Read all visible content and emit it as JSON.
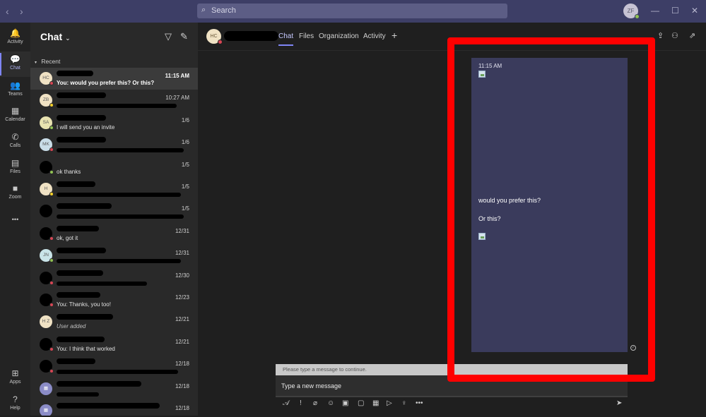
{
  "titlebar": {
    "search_placeholder": "Search",
    "user_initials": "ZF",
    "back_glyph": "‹",
    "forward_glyph": "›"
  },
  "rail": {
    "items": [
      {
        "label": "Activity",
        "icon": "bell-icon",
        "glyph": "🔔"
      },
      {
        "label": "Chat",
        "icon": "chat-icon",
        "glyph": "💬"
      },
      {
        "label": "Teams",
        "icon": "teams-icon",
        "glyph": "👥"
      },
      {
        "label": "Calendar",
        "icon": "calendar-icon",
        "glyph": "▦"
      },
      {
        "label": "Calls",
        "icon": "phone-icon",
        "glyph": "✆"
      },
      {
        "label": "Files",
        "icon": "file-icon",
        "glyph": "▤"
      },
      {
        "label": "Zoom",
        "icon": "camera-icon",
        "glyph": "■"
      },
      {
        "label": "",
        "icon": "more-icon",
        "glyph": "•••"
      }
    ],
    "bottom": [
      {
        "label": "Apps",
        "icon": "apps-icon",
        "glyph": "⊞"
      },
      {
        "label": "Help",
        "icon": "help-icon",
        "glyph": "?"
      }
    ]
  },
  "chatlist": {
    "title": "Chat",
    "recent_label": "Recent",
    "rows": [
      {
        "initials": "HC",
        "avatar_color": "#f0e2c4",
        "status": "#d74654",
        "name_w": 52,
        "preview": "You: would you prefer this? Or this?",
        "time": "11:15 AM",
        "selected": true
      },
      {
        "initials": "ZB",
        "avatar_color": "#f0e2c4",
        "status": "#f8d22a",
        "name_w": 70,
        "preview": "",
        "bar_w": 170,
        "time": "10:27 AM"
      },
      {
        "initials": "SA",
        "avatar_color": "#e8e2b0",
        "status": "#92c353",
        "name_w": 70,
        "preview": "I will send you an invite",
        "time": "1/6"
      },
      {
        "initials": "MK",
        "avatar_color": "#c9dde8",
        "status": "#d74654",
        "name_w": 70,
        "preview": "",
        "bar_w": 180,
        "time": "1/6"
      },
      {
        "initials": "",
        "avatar_color": "#000000",
        "status": "#92c353",
        "name_w": 0,
        "preview": "ok thanks",
        "time": "1/5"
      },
      {
        "initials": "H",
        "avatar_color": "#f0e2c4",
        "status": "#f8d22a",
        "name_w": 55,
        "preview": "",
        "bar_w": 176,
        "time": "1/5"
      },
      {
        "initials": "",
        "avatar_color": "#000000",
        "status": "",
        "name_w": 78,
        "preview": "",
        "bar_w": 180,
        "time": "1/5"
      },
      {
        "initials": "",
        "avatar_color": "#000000",
        "status": "#d74654",
        "name_w": 60,
        "preview": "ok, got it",
        "time": "12/31"
      },
      {
        "initials": "JN",
        "avatar_color": "#c9e4e8",
        "status": "#92c353",
        "name_w": 70,
        "preview": "",
        "bar_w": 176,
        "time": "12/31"
      },
      {
        "initials": "",
        "avatar_color": "#000000",
        "status": "#d74654",
        "name_w": 66,
        "preview": "",
        "bar_w": 128,
        "time": "12/30"
      },
      {
        "initials": "",
        "avatar_color": "#000000",
        "status": "#d74654",
        "name_w": 62,
        "preview": "You: Thanks, you too!",
        "time": "12/23"
      },
      {
        "initials": "H Z",
        "avatar_color": "#f0e2c4",
        "status": "",
        "name_w": 80,
        "preview": "User added",
        "italic": true,
        "time": "12/21"
      },
      {
        "initials": "",
        "avatar_color": "#000000",
        "status": "#d74654",
        "name_w": 68,
        "preview": "You: I think that worked",
        "time": "12/21"
      },
      {
        "initials": "",
        "avatar_color": "#000000",
        "status": "#d74654",
        "name_w": 55,
        "preview": "",
        "bar_w": 172,
        "time": "12/18"
      },
      {
        "initials": "▦",
        "avatar_color": "#8b8cc7",
        "status": "",
        "name_w": 120,
        "preview": "",
        "bar_w": 60,
        "time": "12/18"
      },
      {
        "initials": "▦",
        "avatar_color": "#8b8cc7",
        "status": "",
        "name_w": 146,
        "preview": "",
        "time": "12/18"
      }
    ]
  },
  "main": {
    "contact_initials": "HC",
    "tabs": [
      "Chat",
      "Files",
      "Organization",
      "Activity"
    ],
    "add_tab_glyph": "+",
    "message": {
      "time": "11:15 AM",
      "line1": "would you prefer this?",
      "line2": "Or this?"
    },
    "notice": "Please type a message to continue.",
    "compose_placeholder": "Type a new message",
    "toolbar_icons": [
      "format-icon",
      "priority-icon",
      "attach-icon",
      "emoji-icon",
      "gif-icon",
      "sticker-icon",
      "meet-icon",
      "stream-icon",
      "praise-icon",
      "more-icon",
      "send-icon"
    ]
  },
  "colors": {
    "titlebar": "#3d3e66",
    "accent": "#7f85f5",
    "card": "#3a3b5c",
    "highlight": "#ff0000"
  }
}
